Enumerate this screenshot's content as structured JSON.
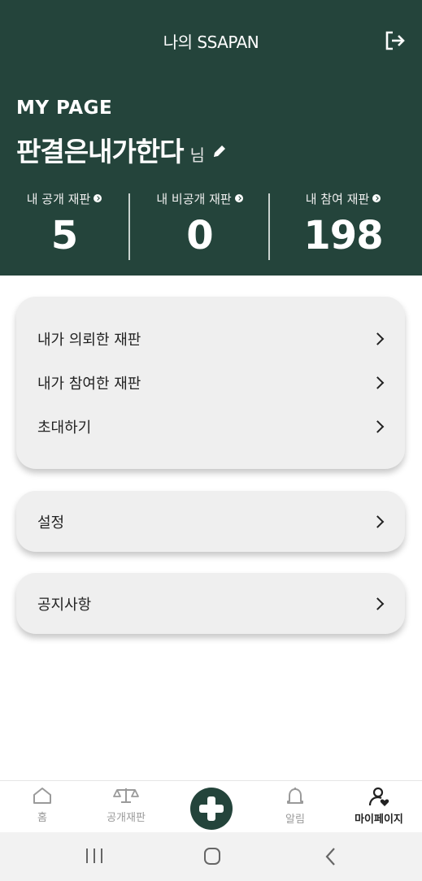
{
  "header": {
    "title": "나의 SSAPAN",
    "logout_icon": "logout-icon",
    "mypage_label": "MY PAGE",
    "user_name": "판결은내가한다",
    "user_suffix": "님",
    "edit_icon": "pencil-icon",
    "background_color": "#24443b"
  },
  "stats": [
    {
      "label": "내 공개 재판",
      "value": "5"
    },
    {
      "label": "내 비공개 재판",
      "value": "0"
    },
    {
      "label": "내 참여 재판",
      "value": "198"
    }
  ],
  "menu": {
    "group1": [
      {
        "label": "내가 의뢰한 재판"
      },
      {
        "label": "내가 참여한 재판"
      },
      {
        "label": "초대하기"
      }
    ],
    "settings": {
      "label": "설정"
    },
    "notices": {
      "label": "공지사항"
    }
  },
  "bottom_nav": [
    {
      "label": "홈",
      "icon": "home-icon"
    },
    {
      "label": "공개재판",
      "icon": "scale-icon"
    },
    {
      "label": "",
      "icon": "plus-icon"
    },
    {
      "label": "알림",
      "icon": "bell-icon"
    },
    {
      "label": "마이페이지",
      "icon": "user-heart-icon",
      "active": true
    }
  ],
  "system_nav": [
    "recent-apps-icon",
    "home-button-icon",
    "back-icon"
  ]
}
